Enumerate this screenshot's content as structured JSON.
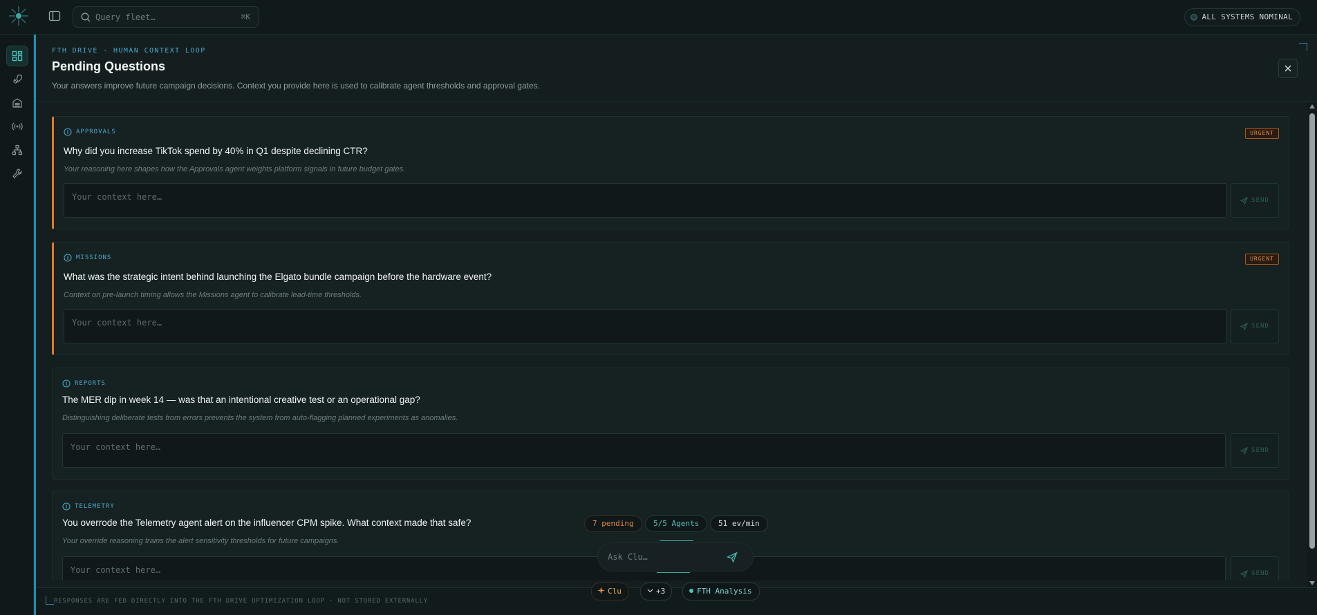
{
  "topbar": {
    "search_placeholder": "Query fleet…",
    "search_shortcut": "⌘K",
    "status_text": "ALL SYSTEMS NOMINAL"
  },
  "rail": {
    "items": [
      {
        "icon": "dashboard-icon",
        "active": true
      },
      {
        "icon": "rocket-icon",
        "active": false
      },
      {
        "icon": "warehouse-icon",
        "active": false
      },
      {
        "icon": "broadcast-icon",
        "active": false
      },
      {
        "icon": "hierarchy-icon",
        "active": false
      },
      {
        "icon": "wrench-icon",
        "active": false
      }
    ]
  },
  "panel": {
    "eyebrow": "FTH DRIVE · HUMAN CONTEXT LOOP",
    "title": "Pending Questions",
    "subtitle": "Your answers improve future campaign decisions. Context you provide here is used to calibrate agent thresholds and approval gates.",
    "footer": "RESPONSES ARE FED DIRECTLY INTO THE FTH DRIVE OPTIMIZATION LOOP · NOT STORED EXTERNALLY"
  },
  "questions": [
    {
      "category": "APPROVALS",
      "badge": "URGENT",
      "question": "Why did you increase TikTok spend by 40% in Q1 despite declining CTR?",
      "hint": "Your reasoning here shapes how the Approvals agent weights platform signals in future budget gates.",
      "placeholder": "Your context here…",
      "send_label": "SEND"
    },
    {
      "category": "MISSIONS",
      "badge": "URGENT",
      "question": "What was the strategic intent behind launching the Elgato bundle campaign before the hardware event?",
      "hint": "Context on pre-launch timing allows the Missions agent to calibrate lead-time thresholds.",
      "placeholder": "Your context here…",
      "send_label": "SEND"
    },
    {
      "category": "REPORTS",
      "badge": "",
      "question": "The MER dip in week 14 — was that an intentional creative test or an operational gap?",
      "hint": "Distinguishing deliberate tests from errors prevents the system from auto-flagging planned experiments as anomalies.",
      "placeholder": "Your context here…",
      "send_label": "SEND"
    },
    {
      "category": "TELEMETRY",
      "badge": "",
      "question": "You overrode the Telemetry agent alert on the influencer CPM spike. What context made that safe?",
      "hint": "Your override reasoning trains the alert sensitivity thresholds for future campaigns.",
      "placeholder": "Your context here…",
      "send_label": "SEND"
    }
  ],
  "chat": {
    "pending": "7 pending",
    "agents": "5/5 Agents",
    "rate": "51 ev/min",
    "ask_placeholder": "Ask Clu…",
    "clu_label": "Clu",
    "more_label": "+3",
    "analysis_label": "FTH Analysis"
  },
  "colors": {
    "accent_blue": "#4aa7c8",
    "urgent_orange": "#e07a2a",
    "teal": "#3aa9a5"
  }
}
